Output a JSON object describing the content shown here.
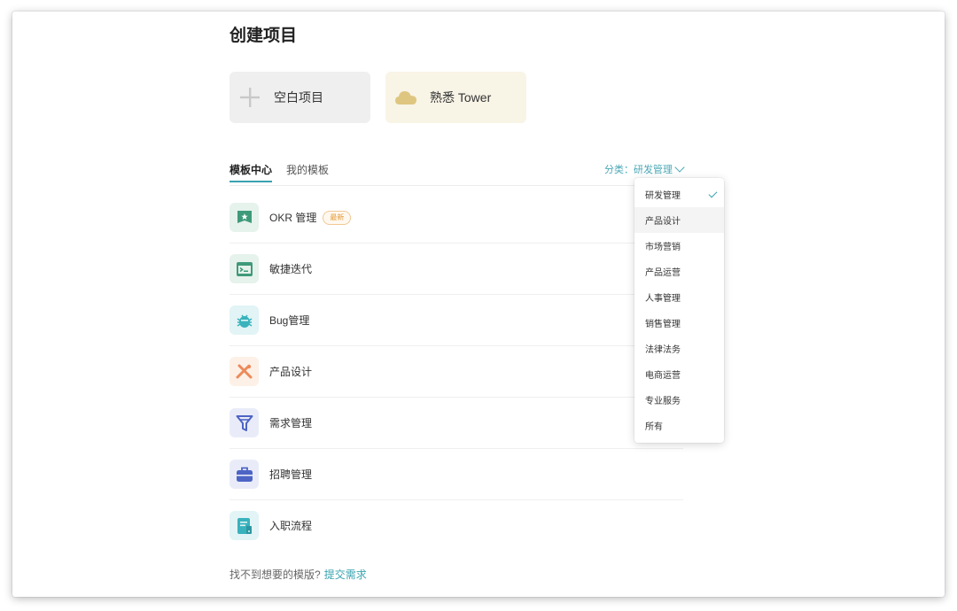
{
  "page": {
    "title": "创建项目"
  },
  "quick_actions": {
    "blank": {
      "label": "空白项目",
      "icon": "plus-icon"
    },
    "tour": {
      "label": "熟悉 Tower",
      "icon": "cloud-icon"
    }
  },
  "tabs": [
    {
      "label": "模板中心",
      "active": true
    },
    {
      "label": "我的模板",
      "active": false
    }
  ],
  "category_filter": {
    "label": "分类：研发管理"
  },
  "templates": [
    {
      "name": "OKR 管理",
      "badge": "最新",
      "icon": "flag-icon",
      "bg": "#e6f2ec",
      "color": "#3f9a7a"
    },
    {
      "name": "敏捷迭代",
      "icon": "terminal-card-icon",
      "bg": "#e6f2ec",
      "color": "#3f9a7a"
    },
    {
      "name": "Bug管理",
      "icon": "bug-icon",
      "bg": "#e2f4f5",
      "color": "#39b2bd"
    },
    {
      "name": "产品设计",
      "icon": "design-tools-icon",
      "bg": "#fdf0e6",
      "color": "#ec8a5a"
    },
    {
      "name": "需求管理",
      "icon": "funnel-icon",
      "bg": "#e9ecf8",
      "color": "#4d64c5"
    },
    {
      "name": "招聘管理",
      "icon": "briefcase-icon",
      "bg": "#e9ecf8",
      "color": "#4d64c5"
    },
    {
      "name": "入职流程",
      "icon": "document-icon",
      "bg": "#e2f4f5",
      "color": "#39b2bd"
    }
  ],
  "footer": {
    "text": "找不到想要的模版?",
    "link": "提交需求"
  },
  "dropdown": {
    "selected": "研发管理",
    "hovered": "产品设计",
    "items": [
      "研发管理",
      "产品设计",
      "市场营销",
      "产品运营",
      "人事管理",
      "销售管理",
      "法律法务",
      "电商运营",
      "专业服务",
      "所有"
    ]
  },
  "colors": {
    "accent": "#3aa3b0",
    "badge": "#e49a3a"
  }
}
